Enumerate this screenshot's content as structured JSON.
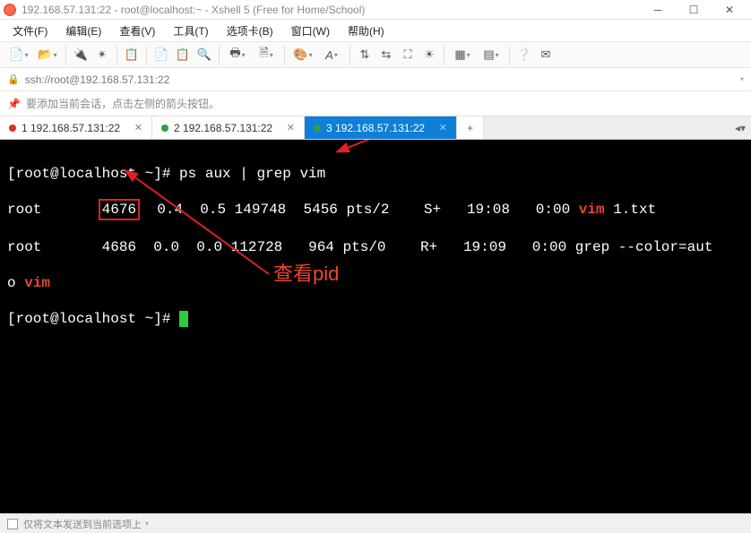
{
  "window": {
    "title": "192.168.57.131:22 - root@localhost:~ - Xshell 5 (Free for Home/School)"
  },
  "menus": {
    "file": "文件(F)",
    "edit": "编辑(E)",
    "view": "查看(V)",
    "tools": "工具(T)",
    "tabs": "选项卡(B)",
    "window": "窗口(W)",
    "help": "帮助(H)"
  },
  "address": {
    "url": "ssh://root@192.168.57.131:22"
  },
  "hint": {
    "text": "要添加当前会话，点击左侧的箭头按钮。"
  },
  "tabs": {
    "t1": "1 192.168.57.131:22",
    "t2": "2 192.168.57.131:22",
    "t3": "3 192.168.57.131:22"
  },
  "terminal": {
    "prompt1_a": "[root@localhost ~]# ",
    "cmd1": "ps aux | grep vim",
    "row1": {
      "user": "root",
      "pid": "4676",
      "cpu": "0.4",
      "mem": "0.5",
      "vsz": "149748",
      "rss": "5456",
      "tty": "pts/2",
      "stat": "S+",
      "start": "19:08",
      "time": "0:00 ",
      "cmd_a": "vim",
      "cmd_b": " 1.txt"
    },
    "row2": {
      "user": "root",
      "pid": "4686",
      "cpu": "0.0",
      "mem": "0.0",
      "vsz": "112728",
      "rss": "964",
      "tty": "pts/0",
      "stat": "R+",
      "start": "19:09",
      "time": "0:00 grep --color=aut"
    },
    "row2b_a": "o ",
    "row2b_b": "vim",
    "prompt2": "[root@localhost ~]# "
  },
  "annotation": {
    "label": "查看pid"
  },
  "status": {
    "text": "仅将文本发送到当前选项上"
  }
}
